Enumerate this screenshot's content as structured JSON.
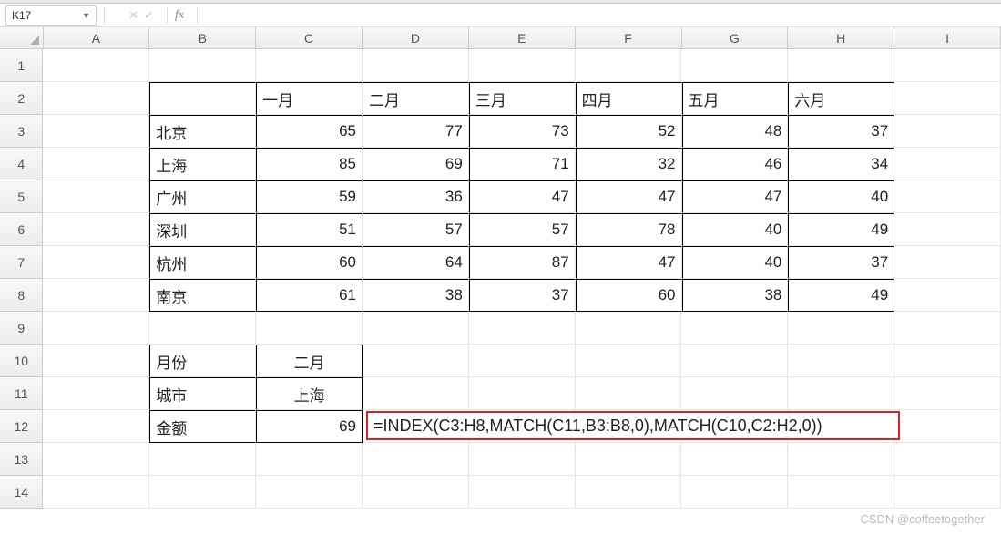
{
  "name_box": {
    "value": "K17"
  },
  "formula_bar": {
    "fx_label": "fx",
    "value": ""
  },
  "columns": [
    "A",
    "B",
    "C",
    "D",
    "E",
    "F",
    "G",
    "H",
    "I"
  ],
  "row_numbers": [
    1,
    2,
    3,
    4,
    5,
    6,
    7,
    8,
    9,
    10,
    11,
    12,
    13,
    14
  ],
  "table": {
    "months": [
      "一月",
      "二月",
      "三月",
      "四月",
      "五月",
      "六月"
    ],
    "cities": [
      "北京",
      "上海",
      "广州",
      "深圳",
      "杭州",
      "南京"
    ],
    "data": [
      [
        65,
        77,
        73,
        52,
        48,
        37
      ],
      [
        85,
        69,
        71,
        32,
        46,
        34
      ],
      [
        59,
        36,
        47,
        47,
        47,
        40
      ],
      [
        51,
        57,
        57,
        78,
        40,
        49
      ],
      [
        60,
        64,
        87,
        47,
        40,
        37
      ],
      [
        61,
        38,
        37,
        60,
        38,
        49
      ]
    ]
  },
  "lookup": {
    "month_label": "月份",
    "month_value": "二月",
    "city_label": "城市",
    "city_value": "上海",
    "amount_label": "金额",
    "amount_value": "69"
  },
  "formula_display": "=INDEX(C3:H8,MATCH(C11,B3:B8,0),MATCH(C10,C2:H2,0))",
  "watermark": "CSDN @coffeetogether"
}
